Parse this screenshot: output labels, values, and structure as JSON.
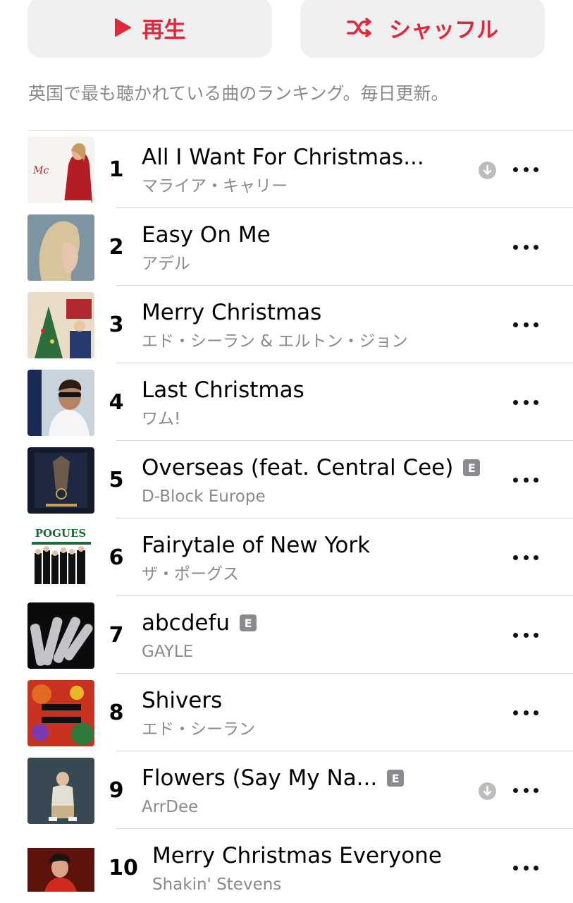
{
  "actions": {
    "play_label": "再生",
    "shuffle_label": "シャッフル"
  },
  "description": "英国で最も聴かれている曲のランキング。毎日更新。",
  "tracks": [
    {
      "rank": "1",
      "title": "All I Want For Christmas...",
      "artist": "マライア・キャリー",
      "explicit": false,
      "download": true,
      "art": "mariah"
    },
    {
      "rank": "2",
      "title": "Easy On Me",
      "artist": "アデル",
      "explicit": false,
      "download": false,
      "art": "adele"
    },
    {
      "rank": "3",
      "title": "Merry Christmas",
      "artist": "エド・シーラン & エルトン・ジョン",
      "explicit": false,
      "download": false,
      "art": "merry"
    },
    {
      "rank": "4",
      "title": "Last Christmas",
      "artist": "ワム!",
      "explicit": false,
      "download": false,
      "art": "wham"
    },
    {
      "rank": "5",
      "title": "Overseas (feat. Central Cee)",
      "artist": "D-Block Europe",
      "explicit": true,
      "download": false,
      "art": "dblock"
    },
    {
      "rank": "6",
      "title": "Fairytale of New York",
      "artist": "ザ・ポーグス",
      "explicit": false,
      "download": false,
      "art": "pogues",
      "art_text": "POGUES"
    },
    {
      "rank": "7",
      "title": "abcdefu",
      "artist": "GAYLE",
      "explicit": true,
      "download": false,
      "art": "gayle"
    },
    {
      "rank": "8",
      "title": "Shivers",
      "artist": "エド・シーラン",
      "explicit": false,
      "download": false,
      "art": "shivers"
    },
    {
      "rank": "9",
      "title": "Flowers (Say My Na...",
      "artist": "ArrDee",
      "explicit": true,
      "download": true,
      "art": "arrdee"
    },
    {
      "rank": "10",
      "title": "Merry Christmas Everyone",
      "artist": "Shakin' Stevens",
      "explicit": false,
      "download": false,
      "art": "shakin"
    }
  ],
  "explicit_badge": "E",
  "colors": {
    "accent": "#e0283d",
    "button_bg": "#efeff0",
    "secondary_text": "#8a8a8e",
    "separator": "#d4d4d8"
  }
}
